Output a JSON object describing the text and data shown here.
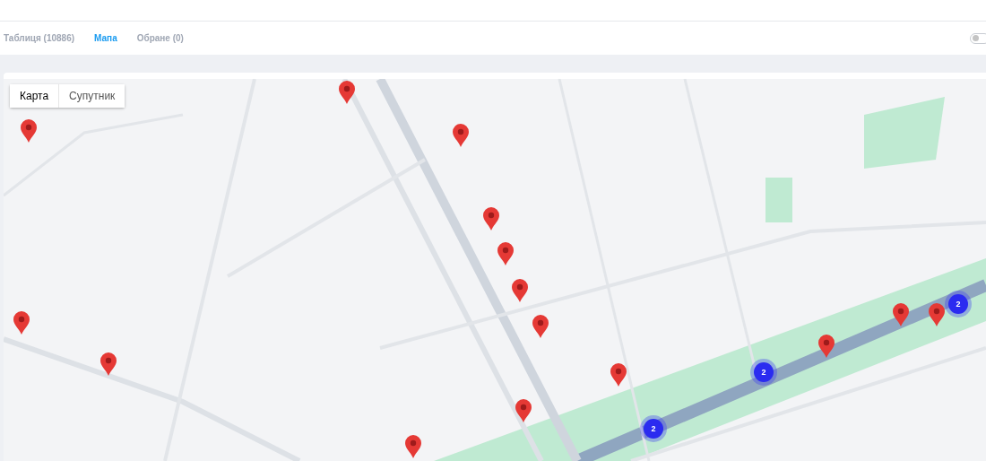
{
  "tabs": [
    {
      "label": "Таблиця (10886)",
      "selected": false
    },
    {
      "label": "Мапа",
      "selected": true
    },
    {
      "label": "Обране (0)",
      "selected": false
    }
  ],
  "toggle": {
    "on": false
  },
  "map": {
    "map_types": [
      {
        "label": "Карта",
        "selected": true
      },
      {
        "label": "Супутник",
        "selected": false
      }
    ],
    "clusters": [
      {
        "count": "2"
      },
      {
        "count": "2"
      },
      {
        "count": "2"
      }
    ]
  }
}
